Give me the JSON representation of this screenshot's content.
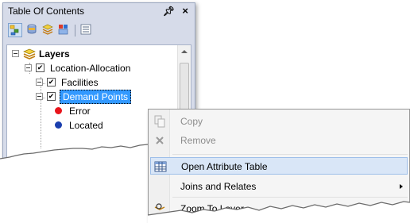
{
  "toc": {
    "title": "Table Of Contents",
    "pin_glyph": "↕",
    "close_glyph": "×",
    "toolbar_icons": [
      "list-by-drawing-order-icon",
      "list-by-source-icon",
      "list-by-visibility-icon",
      "list-by-selection-icon",
      "options-icon"
    ],
    "tree": {
      "root_label": "Layers",
      "group_label": "Location-Allocation",
      "facilities_label": "Facilities",
      "demand_points_label": "Demand Points",
      "error_label": "Error",
      "located_label": "Located"
    },
    "colors": {
      "selected": "#3399ff",
      "error_dot": "#e8141b",
      "located_dot": "#1b3fae"
    }
  },
  "context_menu": {
    "items": [
      {
        "label": "Copy",
        "disabled": true,
        "icon": "copy-icon"
      },
      {
        "label": "Remove",
        "disabled": true,
        "icon": "remove-icon"
      },
      {
        "label": "Open Attribute Table",
        "disabled": false,
        "icon": "table-icon",
        "highlighted": true
      },
      {
        "label": "Joins and Relates",
        "disabled": false,
        "icon": "",
        "submenu": true
      },
      {
        "label": "Zoom To Layer",
        "disabled": false,
        "icon": "zoom-to-layer-icon"
      }
    ]
  }
}
